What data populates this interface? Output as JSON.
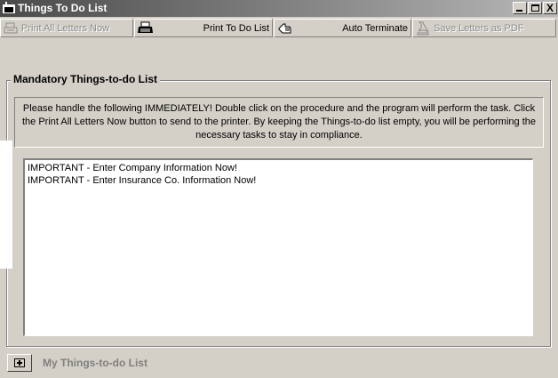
{
  "window": {
    "title": "Things To Do List",
    "icon": "app-window-icon"
  },
  "title_buttons": {
    "minimize": "minimize-icon",
    "maximize": "maximize-icon",
    "close": "X"
  },
  "toolbar": {
    "print_all_label": "Print All Letters Now",
    "print_all_icon": "printer-icon",
    "print_all_enabled": false,
    "print_todo_label": "Print To Do List",
    "print_todo_icon": "printer-icon",
    "print_todo_enabled": true,
    "auto_terminate_label": "Auto Terminate",
    "auto_terminate_icon": "hand-pointer-icon",
    "auto_terminate_enabled": true,
    "save_pdf_label": "Save Letters as PDF",
    "save_pdf_icon": "pdf-document-icon",
    "save_pdf_enabled": false
  },
  "mandatory": {
    "title": "Mandatory Things-to-do List",
    "instructions": "Please handle the following IMMEDIATELY!  Double click on the procedure and the program will perform the task.  Click the Print All Letters Now button to send to the printer.  By keeping the Things-to-do list empty, you will be performing the necessary tasks to stay in compliance.",
    "items": [
      "IMPORTANT - Enter Company Information Now!",
      "IMPORTANT - Enter Insurance Co. Information Now!"
    ]
  },
  "my_list": {
    "label": "My Things-to-do List",
    "expand_icon": "expand-plus-icon"
  },
  "colors": {
    "face": "#d4d0c8",
    "titlebar_dark": "#4a4a4a",
    "disabled_text": "#8c8c8c"
  }
}
